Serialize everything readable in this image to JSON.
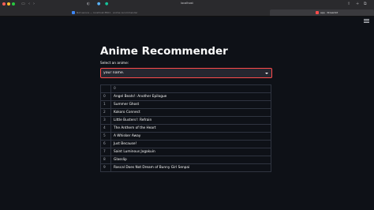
{
  "browser": {
    "window_title": "localhost",
    "tabs": [
      {
        "label": "Not secure — localhost:8501 · anime recommender"
      },
      {
        "label": "app · Streamlit"
      }
    ],
    "colors": {
      "accent": "#ff4b4b",
      "link": "#3d86f5"
    }
  },
  "app": {
    "title": "Anime Recommender",
    "select_label": "Select an anime:",
    "select_value": "your name.",
    "table": {
      "header": "0",
      "rows": [
        {
          "index": "0",
          "name": "Angel Beats!: Another Epilogue"
        },
        {
          "index": "1",
          "name": "Summer Ghost"
        },
        {
          "index": "2",
          "name": "Kokoro Connect"
        },
        {
          "index": "3",
          "name": "Little Busters!: Refrain"
        },
        {
          "index": "4",
          "name": "The Anthem of the Heart"
        },
        {
          "index": "5",
          "name": "A Whisker Away"
        },
        {
          "index": "6",
          "name": "Just Because!"
        },
        {
          "index": "7",
          "name": "Saint Luminous Jogakuin"
        },
        {
          "index": "8",
          "name": "Glasslip"
        },
        {
          "index": "9",
          "name": "Rascal Does Not Dream of Bunny Girl Senpai"
        }
      ]
    }
  }
}
